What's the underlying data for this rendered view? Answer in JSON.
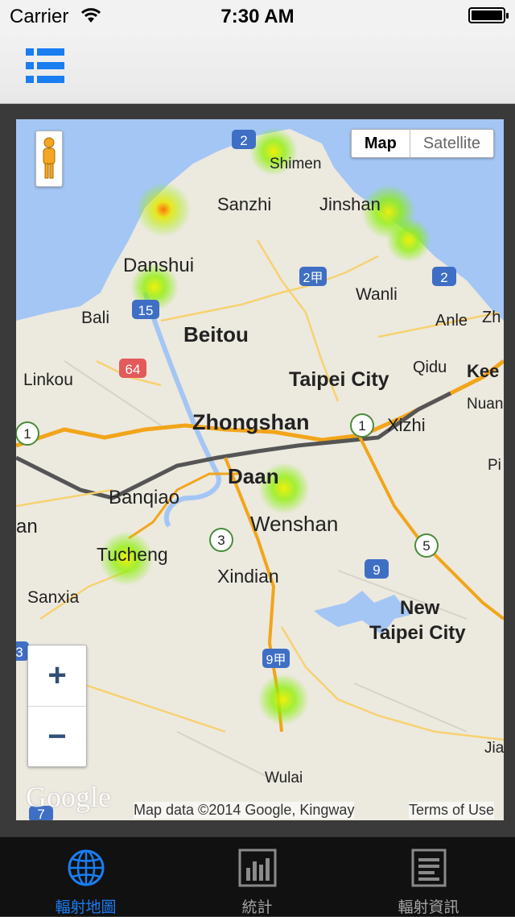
{
  "status_bar": {
    "carrier": "Carrier",
    "time": "7:30 AM"
  },
  "nav": {
    "menu_icon": "list-icon"
  },
  "map": {
    "map_type": {
      "map": "Map",
      "satellite": "Satellite",
      "selected": "Map"
    },
    "zoom_in": "+",
    "zoom_out": "−",
    "google_logo": "Google",
    "attribution": "Map data ©2014 Google, Kingway",
    "terms": "Terms of Use",
    "places": {
      "shimen": "Shimen",
      "sanzhi": "Sanzhi",
      "jinshan": "Jinshan",
      "danshui": "Danshui",
      "wanli": "Wanli",
      "bali": "Bali",
      "beitou": "Beitou",
      "anle": "Anle",
      "linkou": "Linkou",
      "taipei_city": "Taipei City",
      "qidu": "Qidu",
      "kee": "Kee",
      "nuan": "Nuan",
      "zhongshan": "Zhongshan",
      "xizhi": "Xizhi",
      "banqiao": "Banqiao",
      "daan": "Daan",
      "wenshan": "Wenshan",
      "an": "an",
      "tucheng": "Tucheng",
      "xindian": "Xindian",
      "sanxia": "Sanxia",
      "new": "New",
      "new_taipei_city": "Taipei City",
      "wulai": "Wulai",
      "jia": "Jia",
      "zh": "Zh",
      "pi": "Pi"
    },
    "shields": [
      "2",
      "2甲",
      "2",
      "15",
      "64",
      "1",
      "1",
      "3",
      "5",
      "9",
      "9甲",
      "3",
      "7"
    ]
  },
  "tabs": [
    {
      "label": "輻射地圖",
      "icon": "globe-icon",
      "active": true
    },
    {
      "label": "統計",
      "icon": "bar-chart-icon",
      "active": false
    },
    {
      "label": "輻射資訊",
      "icon": "document-icon",
      "active": false
    }
  ],
  "colors": {
    "accent": "#1a7df0",
    "tab_bg": "#111111",
    "water": "#a4c6f5",
    "road": "#f7b634",
    "heat": "#7cf000"
  }
}
